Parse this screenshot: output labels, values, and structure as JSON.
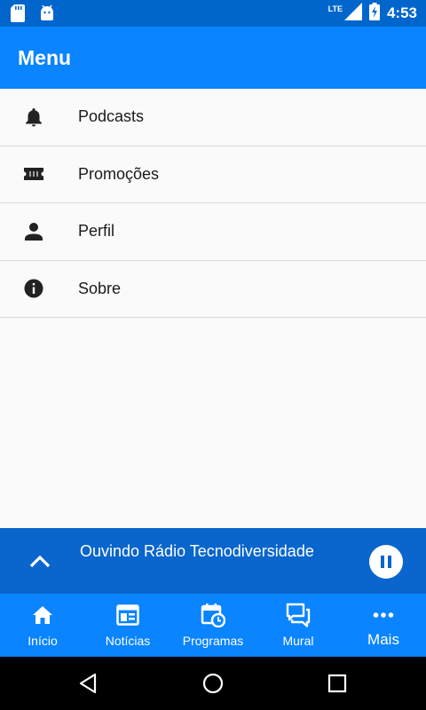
{
  "status_bar": {
    "time": "4:53",
    "network": "LTE",
    "icons": [
      "sd-card-icon",
      "android-icon",
      "signal-icon",
      "battery-charging-icon"
    ]
  },
  "app_bar": {
    "title": "Menu"
  },
  "menu": {
    "items": [
      {
        "label": "Podcasts",
        "icon": "bell-icon"
      },
      {
        "label": "Promoções",
        "icon": "ticket-icon"
      },
      {
        "label": "Perfil",
        "icon": "person-icon"
      },
      {
        "label": "Sobre",
        "icon": "info-icon"
      }
    ]
  },
  "player": {
    "text": "Ouvindo Rádio Tecnodiversidade",
    "expand_icon": "chevron-up-icon",
    "pause_icon": "pause-icon"
  },
  "tabs": [
    {
      "label": "Início",
      "icon": "home-icon"
    },
    {
      "label": "Notícias",
      "icon": "news-icon"
    },
    {
      "label": "Programas",
      "icon": "calendar-clock-icon"
    },
    {
      "label": "Mural",
      "icon": "chat-icon"
    },
    {
      "label": "Mais",
      "icon": "more-icon"
    }
  ],
  "colors": {
    "status_bar": "#0066cc",
    "app_bar": "#0a84ff",
    "player": "#0a66cc",
    "tab_bar": "#0a84ff",
    "background": "#fafafa"
  }
}
